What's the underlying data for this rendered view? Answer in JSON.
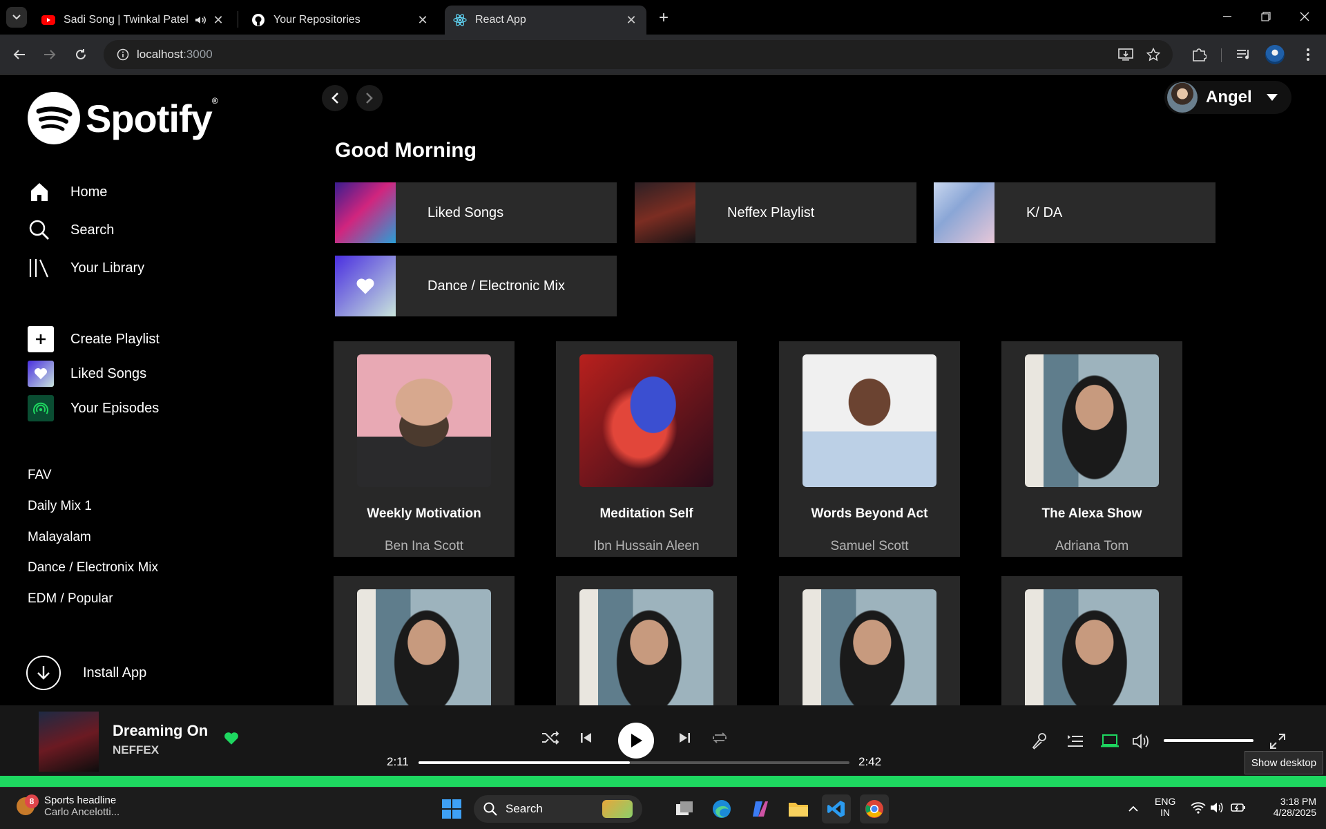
{
  "browser": {
    "tabs": [
      {
        "title": "Sadi Song | Twinkal Patel | C",
        "favicon": "youtube-icon",
        "audio": true
      },
      {
        "title": "Your Repositories",
        "favicon": "github-icon"
      },
      {
        "title": "React App",
        "favicon": "react-icon",
        "active": true
      }
    ],
    "url_host": "localhost",
    "url_port": ":3000"
  },
  "sidebar": {
    "logo_text": "Spotify",
    "logo_mark": "®",
    "nav": [
      {
        "label": "Home",
        "icon": "home-icon"
      },
      {
        "label": "Search",
        "icon": "search-icon"
      },
      {
        "label": "Your Library",
        "icon": "library-icon"
      }
    ],
    "actions": [
      {
        "label": "Create Playlist",
        "icon": "plus-icon"
      },
      {
        "label": "Liked Songs",
        "icon": "heart-icon"
      },
      {
        "label": "Your Episodes",
        "icon": "podcast-icon"
      }
    ],
    "playlists": [
      "FAV",
      "Daily Mix 1",
      "Malayalam",
      "Dance / Electronix Mix",
      "EDM / Popular"
    ],
    "install_label": "Install App"
  },
  "main": {
    "user_name": "Angel",
    "greeting": "Good Morning",
    "quick_picks": [
      {
        "label": "Liked Songs"
      },
      {
        "label": "Neffex Playlist"
      },
      {
        "label": "K/ DA"
      },
      {
        "label": "Dance / Electronic Mix"
      }
    ],
    "cards": [
      {
        "title": "Weekly Motivation",
        "subtitle": "Ben Ina Scott"
      },
      {
        "title": "Meditation Self",
        "subtitle": "Ibn Hussain Aleen"
      },
      {
        "title": "Words Beyond Act",
        "subtitle": "Samuel Scott"
      },
      {
        "title": "The Alexa Show",
        "subtitle": "Adriana Tom"
      }
    ]
  },
  "player": {
    "title": "Dreaming On",
    "artist": "NEFFEX",
    "elapsed": "2:11",
    "duration": "2:42",
    "progress_fraction": 0.49,
    "volume_fraction": 1.0,
    "liked": true
  },
  "tooltip": "Show desktop",
  "taskbar": {
    "news_badge": "8",
    "news_title": "Sports headline",
    "news_sub": "Carlo Ancelotti...",
    "search_label": "Search",
    "lang_top": "ENG",
    "lang_bottom": "IN",
    "time": "3:18 PM",
    "date": "4/28/2025"
  },
  "colors": {
    "spotify_green": "#1ed760",
    "card_bg": "#282828",
    "quick_bg": "#2a2a2a"
  }
}
